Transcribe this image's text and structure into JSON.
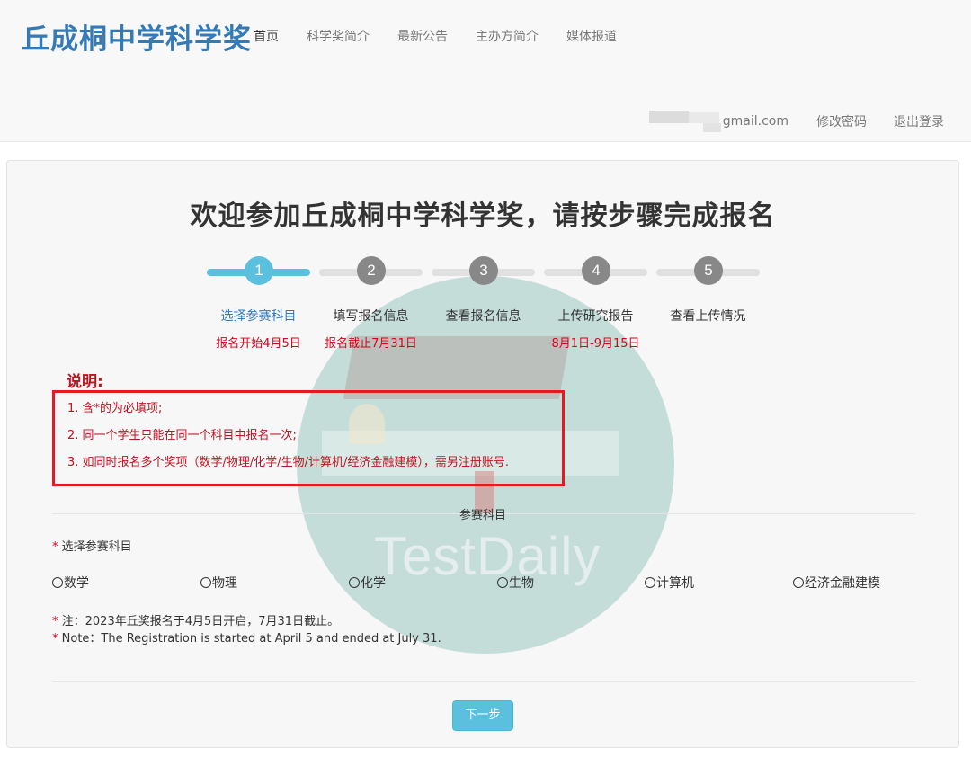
{
  "navbar": {
    "brand": "丘成桐中学科学奖",
    "links": [
      "首页",
      "科学奖简介",
      "最新公告",
      "主办方简介",
      "媒体报道"
    ],
    "active_link": "首页"
  },
  "user": {
    "email_suffix": "gmail.com",
    "change_password": "修改密码",
    "logout": "退出登录"
  },
  "page_title": "欢迎参加丘成桐中学科学奖，请按步骤完成报名",
  "steps": [
    {
      "number": "1",
      "label": "选择参赛科目",
      "date": "报名开始4月5日",
      "active": true
    },
    {
      "number": "2",
      "label": "填写报名信息",
      "date": "报名截止7月31日",
      "active": false
    },
    {
      "number": "3",
      "label": "查看报名信息",
      "date": "",
      "active": false
    },
    {
      "number": "4",
      "label": "上传研究报告",
      "date": "8月1日-9月15日",
      "active": false
    },
    {
      "number": "5",
      "label": "查看上传情况",
      "date": "",
      "active": false
    }
  ],
  "notes": {
    "title": "说明:",
    "items": [
      "1. 含*的为必填项;",
      "2. 同一个学生只能在同一个科目中报名一次;",
      "3. 如同时报名多个奖项（数学/物理/化学/生物/计算机/经济金融建模），需另注册账号."
    ]
  },
  "form": {
    "section_title": "参赛科目",
    "required_mark": "*",
    "subject_label": "选择参赛科目",
    "options": [
      "数学",
      "物理",
      "化学",
      "生物",
      "计算机",
      "经济金融建模"
    ],
    "hint_cn": "注：2023年丘奖报名于4月5日开启，7月31日截止。",
    "hint_en": "Note：The Registration is started at April 5 and ended at July 31."
  },
  "watermark_text": "TestDaily",
  "next_button": "下一步",
  "colors": {
    "brand": "#337ab7",
    "step_active": "#5bc0de",
    "step_inactive": "#888888",
    "required": "#d9001b",
    "note_text": "#c1121f",
    "highlight_box": "#e21b23"
  }
}
